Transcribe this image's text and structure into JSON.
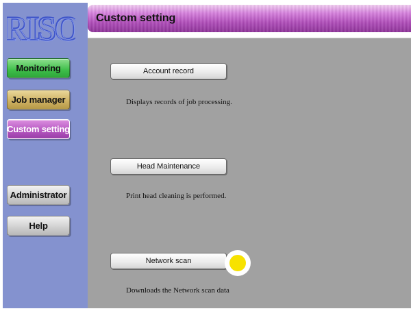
{
  "brand": {
    "logo_text": "RISO",
    "logo_color": "#4a5fd0"
  },
  "sidebar": {
    "items": [
      {
        "label": "Monitoring",
        "color": "#3fbe4a"
      },
      {
        "label": "Job manager",
        "color": "#cdb061"
      },
      {
        "label": "Custom setting",
        "color": "#b355bf",
        "selected": true
      },
      {
        "label": "Administrator",
        "color": "#cfcfcf"
      },
      {
        "label": "Help",
        "color": "#cfcfcf"
      }
    ]
  },
  "header": {
    "title": "Custom setting",
    "color": "#b04cba"
  },
  "main": {
    "actions": [
      {
        "label": "Account record",
        "description": "Displays records of job processing."
      },
      {
        "label": "Head Maintenance",
        "description": "Print head cleaning is performed."
      },
      {
        "label": "Network scan",
        "description": "Downloads the Network scan data"
      }
    ]
  },
  "cursor": {
    "color": "#f7e200"
  }
}
